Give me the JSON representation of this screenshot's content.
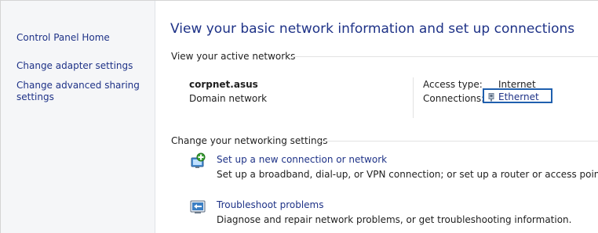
{
  "sidebar": {
    "home_link": "Control Panel Home",
    "links": [
      "Change adapter settings",
      "Change advanced sharing settings"
    ]
  },
  "main": {
    "title": "View your basic network information and set up connections",
    "active_networks_heading": "View your active networks",
    "network": {
      "name": "corpnet.asus",
      "category": "Domain network",
      "access_type_label": "Access type:",
      "access_type_value": "Internet",
      "connections_label": "Connections:",
      "connection_name": "Ethernet"
    },
    "settings_heading": "Change your networking settings",
    "tasks": [
      {
        "link": "Set up a new connection or network",
        "desc": "Set up a broadband, dial-up, or VPN connection; or set up a router or access point.",
        "icon": "new-connection-icon"
      },
      {
        "link": "Troubleshoot problems",
        "desc": "Diagnose and repair network problems, or get troubleshooting information.",
        "icon": "troubleshoot-icon"
      }
    ]
  },
  "colors": {
    "link": "#1e3287",
    "highlight_border": "#1f5fae",
    "sidebar_bg": "#f5f6f8"
  }
}
